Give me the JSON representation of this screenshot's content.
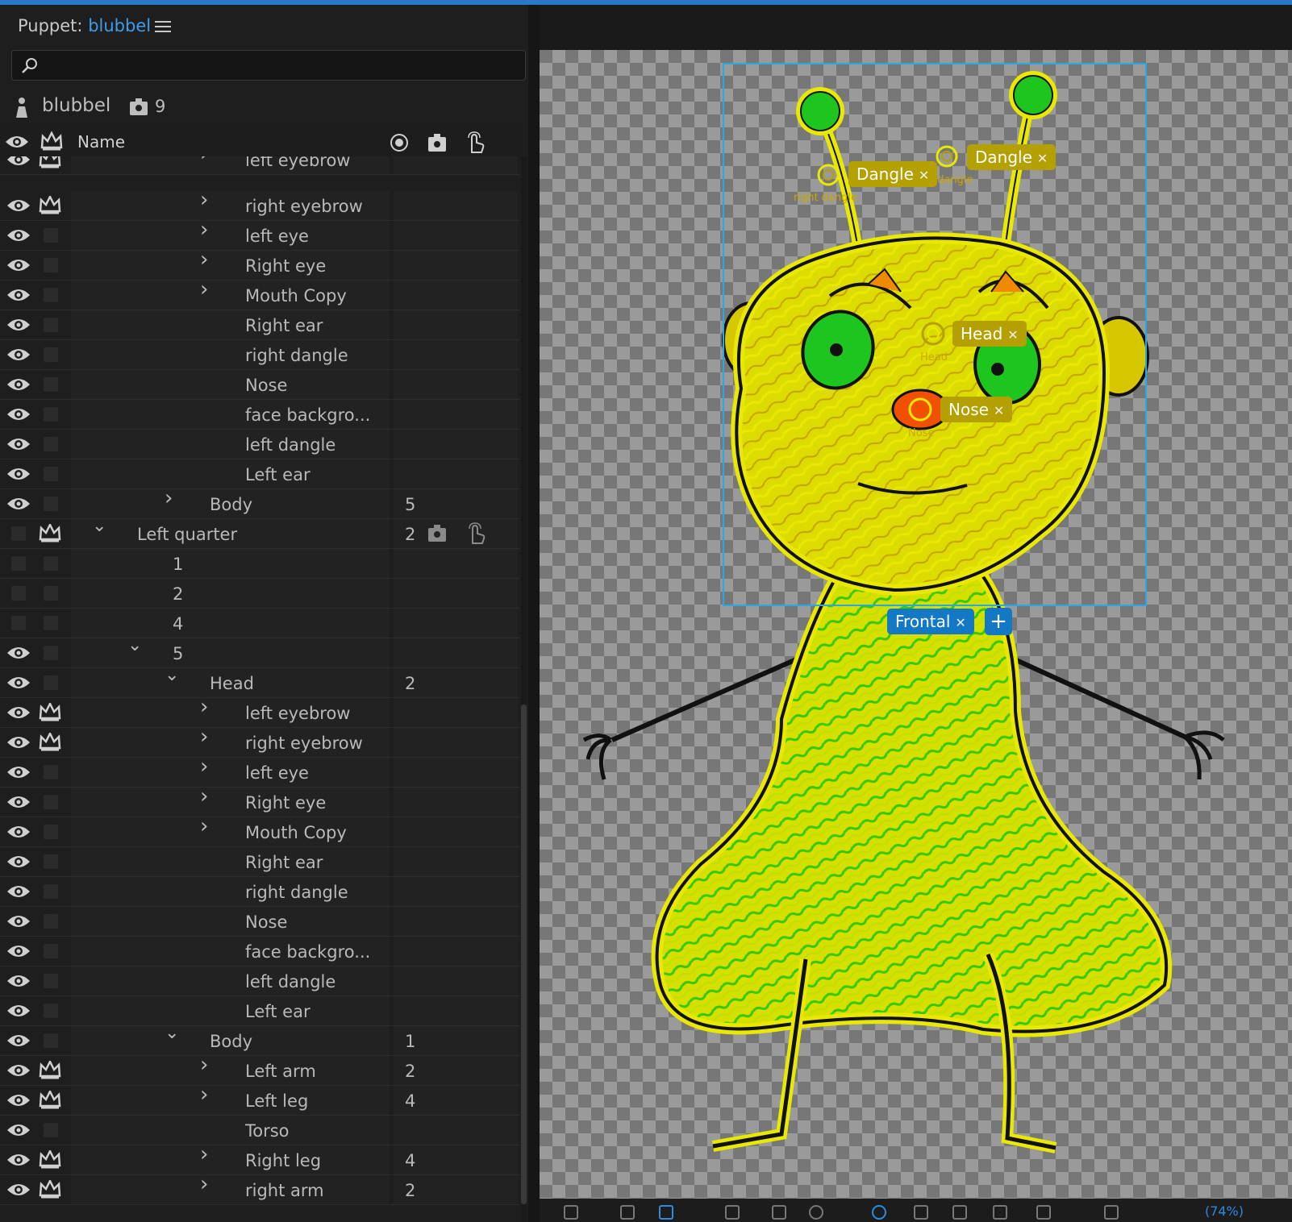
{
  "panel": {
    "title_prefix": "Puppet:",
    "title_name": "blubbel",
    "puppet_name": "blubbel",
    "puppet_count": "9",
    "search_placeholder": ""
  },
  "columns": {
    "name": "Name"
  },
  "rows": [
    {
      "eye": true,
      "crown": true,
      "indent": 5,
      "chevron": "right",
      "label": "left eyebrow",
      "num": "",
      "partial": true
    },
    {
      "eye": true,
      "crown": true,
      "indent": 5,
      "chevron": "right",
      "label": "right eyebrow",
      "num": ""
    },
    {
      "eye": true,
      "crown": false,
      "indent": 5,
      "chevron": "right",
      "label": "left eye",
      "num": ""
    },
    {
      "eye": true,
      "crown": false,
      "indent": 5,
      "chevron": "right",
      "label": "Right eye",
      "num": ""
    },
    {
      "eye": true,
      "crown": false,
      "indent": 5,
      "chevron": "right",
      "label": "Mouth Copy",
      "num": ""
    },
    {
      "eye": true,
      "crown": false,
      "indent": 5,
      "chevron": "",
      "label": "Right ear",
      "num": ""
    },
    {
      "eye": true,
      "crown": false,
      "indent": 5,
      "chevron": "",
      "label": "right dangle",
      "num": ""
    },
    {
      "eye": true,
      "crown": false,
      "indent": 5,
      "chevron": "",
      "label": "Nose",
      "num": ""
    },
    {
      "eye": true,
      "crown": false,
      "indent": 5,
      "chevron": "",
      "label": "face backgro...",
      "num": ""
    },
    {
      "eye": true,
      "crown": false,
      "indent": 5,
      "chevron": "",
      "label": "left dangle",
      "num": ""
    },
    {
      "eye": true,
      "crown": false,
      "indent": 5,
      "chevron": "",
      "label": "Left ear",
      "num": ""
    },
    {
      "eye": true,
      "crown": false,
      "indent": 4,
      "chevron": "right",
      "label": "Body",
      "num": "5"
    },
    {
      "eye": false,
      "crown": true,
      "indent": 2,
      "chevron": "down",
      "label": "Left quarter",
      "num": "2",
      "icons": true
    },
    {
      "eye": false,
      "crown": false,
      "indent": 3,
      "chevron": "",
      "label": "1",
      "num": ""
    },
    {
      "eye": false,
      "crown": false,
      "indent": 3,
      "chevron": "",
      "label": "2",
      "num": ""
    },
    {
      "eye": false,
      "crown": false,
      "indent": 3,
      "chevron": "",
      "label": "4",
      "num": ""
    },
    {
      "eye": true,
      "crown": false,
      "indent": 3,
      "chevron": "down",
      "label": "5",
      "num": ""
    },
    {
      "eye": true,
      "crown": false,
      "indent": 4,
      "chevron": "down",
      "label": "Head",
      "num": "2"
    },
    {
      "eye": true,
      "crown": true,
      "indent": 5,
      "chevron": "right",
      "label": "left eyebrow",
      "num": ""
    },
    {
      "eye": true,
      "crown": true,
      "indent": 5,
      "chevron": "right",
      "label": "right eyebrow",
      "num": ""
    },
    {
      "eye": true,
      "crown": false,
      "indent": 5,
      "chevron": "right",
      "label": "left eye",
      "num": ""
    },
    {
      "eye": true,
      "crown": false,
      "indent": 5,
      "chevron": "right",
      "label": "Right eye",
      "num": ""
    },
    {
      "eye": true,
      "crown": false,
      "indent": 5,
      "chevron": "right",
      "label": "Mouth Copy",
      "num": ""
    },
    {
      "eye": true,
      "crown": false,
      "indent": 5,
      "chevron": "",
      "label": "Right ear",
      "num": ""
    },
    {
      "eye": true,
      "crown": false,
      "indent": 5,
      "chevron": "",
      "label": "right dangle",
      "num": ""
    },
    {
      "eye": true,
      "crown": false,
      "indent": 5,
      "chevron": "",
      "label": "Nose",
      "num": ""
    },
    {
      "eye": true,
      "crown": false,
      "indent": 5,
      "chevron": "",
      "label": "face backgro...",
      "num": ""
    },
    {
      "eye": true,
      "crown": false,
      "indent": 5,
      "chevron": "",
      "label": "left dangle",
      "num": ""
    },
    {
      "eye": true,
      "crown": false,
      "indent": 5,
      "chevron": "",
      "label": "Left ear",
      "num": ""
    },
    {
      "eye": true,
      "crown": false,
      "indent": 4,
      "chevron": "down",
      "label": "Body",
      "num": "1"
    },
    {
      "eye": true,
      "crown": true,
      "indent": 5,
      "chevron": "right",
      "label": "Left arm",
      "num": "2"
    },
    {
      "eye": true,
      "crown": true,
      "indent": 5,
      "chevron": "right",
      "label": "Left leg",
      "num": "4"
    },
    {
      "eye": true,
      "crown": false,
      "indent": 5,
      "chevron": "",
      "label": "Torso",
      "num": ""
    },
    {
      "eye": true,
      "crown": true,
      "indent": 5,
      "chevron": "right",
      "label": "Right leg",
      "num": "4"
    },
    {
      "eye": true,
      "crown": true,
      "indent": 5,
      "chevron": "right",
      "label": "right arm",
      "num": "2"
    }
  ],
  "stage": {
    "tags": {
      "dangle_left": "Dangle",
      "dangle_right": "Dangle",
      "head": "Head",
      "nose": "Nose",
      "frontal": "Frontal"
    },
    "handle_labels": {
      "right_dangle": "right dangle",
      "left_dangle": "left dangle",
      "head": "Head",
      "nose": "Nose"
    },
    "tag_close": "✕",
    "add_symbol": "+"
  },
  "toolbar": {
    "zoom": "(74%)"
  },
  "colors": {
    "accent": "#3d9ded",
    "tag_yellow": "#b4a000",
    "tag_blue": "#1479c5",
    "selection": "#28a9e6"
  }
}
